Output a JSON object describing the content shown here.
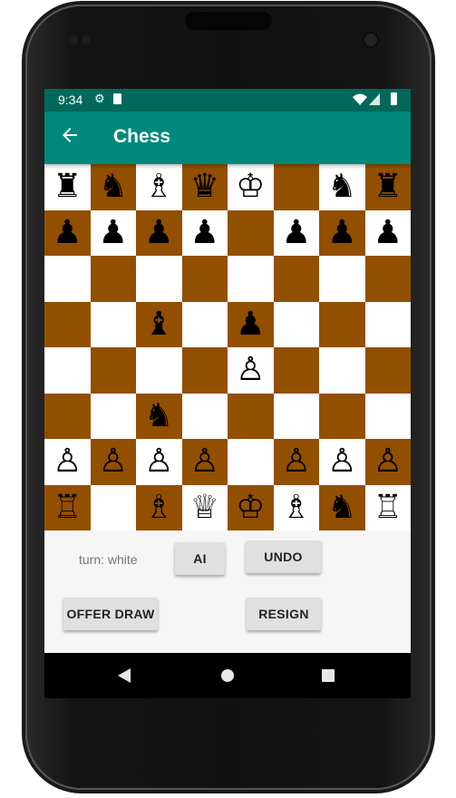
{
  "status_bar": {
    "time": "9:34",
    "left_icons": [
      "settings-icon",
      "sd-card-icon"
    ],
    "right_icons": [
      "wifi-icon",
      "signal-icon",
      "battery-icon"
    ]
  },
  "app_bar": {
    "title": "Chess",
    "back_icon": "arrow-back-icon",
    "color": "#00897b",
    "status_color": "#00695c"
  },
  "board": {
    "light_color": "#ffffff",
    "dark_color": "#934f00",
    "ranks": [
      [
        "♜",
        "♞",
        "♗",
        "♛",
        "♔",
        "",
        "♞",
        "♜"
      ],
      [
        "♟",
        "♟",
        "♟",
        "♟",
        "",
        "♟",
        "♟",
        "♟"
      ],
      [
        "",
        "",
        "",
        "",
        "",
        "",
        "",
        ""
      ],
      [
        "",
        "",
        "♝",
        "",
        "♟",
        "",
        "",
        ""
      ],
      [
        "",
        "",
        "",
        "",
        "♙",
        "",
        "",
        ""
      ],
      [
        "",
        "",
        "♞",
        "",
        "",
        "",
        "",
        ""
      ],
      [
        "♙",
        "♙",
        "♙",
        "♙",
        "",
        "♙",
        "♙",
        "♙"
      ],
      [
        "♖",
        "",
        "♗",
        "♕",
        "♔",
        "♗",
        "♞",
        "♖"
      ]
    ]
  },
  "controls": {
    "turn_text": "turn: white",
    "ai_label": "AI",
    "undo_label": "UNDO",
    "offer_draw_label": "OFFER DRAW",
    "resign_label": "RESIGN"
  },
  "nav_bar": {
    "icons": [
      "nav-back-icon",
      "nav-home-icon",
      "nav-recents-icon"
    ]
  }
}
